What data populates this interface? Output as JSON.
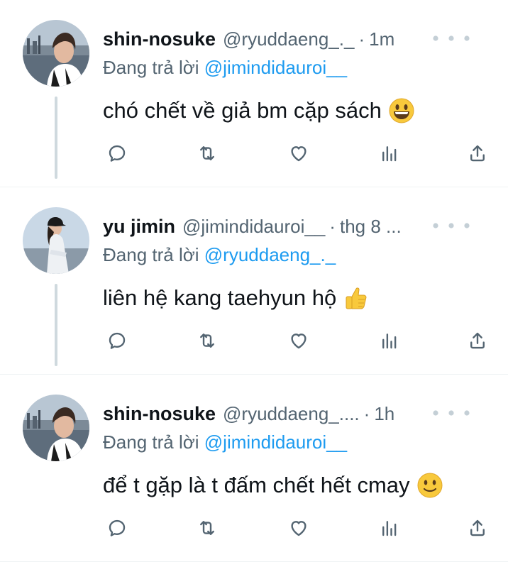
{
  "tweets": [
    {
      "name": "shin-nosuke",
      "handle": "@ryuddaeng_._",
      "separator": "·",
      "time": "1m",
      "reply_prefix": "Đang trả lời ",
      "reply_handle": "@jimindidauroi__",
      "text": "chó chết về giả bm cặp sách",
      "emoji": "grinning-face"
    },
    {
      "name": "yu jimin",
      "handle": "@jimindidauroi__",
      "separator": "·",
      "time": "thg 8 ...",
      "reply_prefix": "Đang trả lời ",
      "reply_handle": "@ryuddaeng_._",
      "text": "liên hệ kang taehyun hộ",
      "emoji": "thumbs-up"
    },
    {
      "name": "shin-nosuke",
      "handle": "@ryuddaeng_....",
      "separator": "·",
      "time": "1h",
      "reply_prefix": "Đang trả lời ",
      "reply_handle": "@jimindidauroi__",
      "text": "để t gặp là t đấm chết hết cmay",
      "emoji": "slightly-smiling-face"
    }
  ],
  "icons": {
    "reply": "reply-icon",
    "retweet": "retweet-icon",
    "like": "heart-icon",
    "views": "views-icon",
    "share": "share-icon",
    "more": "more-icon"
  },
  "colors": {
    "link": "#1d9bf0",
    "secondary": "#536471",
    "thread_line": "#cfd9de",
    "divider": "#eff3f4"
  }
}
